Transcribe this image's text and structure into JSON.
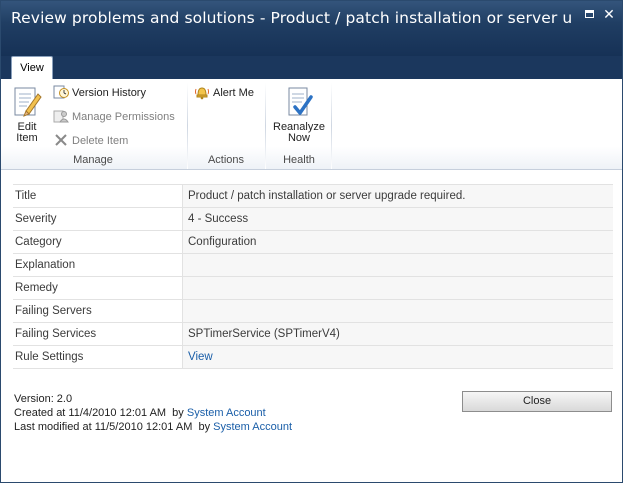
{
  "window": {
    "title": "Review problems and solutions - Product / patch installation or server upgra...",
    "maximize_icon": "maximize-icon",
    "close_label": "✕"
  },
  "ribbon": {
    "tabs": [
      {
        "label": "View",
        "selected": true
      }
    ],
    "manage": {
      "group_label": "Manage",
      "edit_item": {
        "line1": "Edit",
        "line2": "Item"
      },
      "version_history": "Version History",
      "manage_permissions": "Manage Permissions",
      "delete_item": "Delete Item"
    },
    "actions": {
      "group_label": "Actions",
      "alert_me": "Alert Me"
    },
    "health": {
      "group_label": "Health",
      "reanalyze": {
        "line1": "Reanalyze",
        "line2": "Now"
      }
    }
  },
  "properties": [
    {
      "name": "Title",
      "value": "Product / patch installation or server upgrade required."
    },
    {
      "name": "Severity",
      "value": "4 - Success"
    },
    {
      "name": "Category",
      "value": "Configuration"
    },
    {
      "name": "Explanation",
      "value": ""
    },
    {
      "name": "Remedy",
      "value": ""
    },
    {
      "name": "Failing Servers",
      "value": ""
    },
    {
      "name": "Failing Services",
      "value": "SPTimerService (SPTimerV4)"
    },
    {
      "name": "Rule Settings",
      "value": "View",
      "is_link": true
    }
  ],
  "footer": {
    "version": "Version: 2.0",
    "created_prefix": "Created at 11/4/2010 12:01 AM  by ",
    "created_by": "System Account",
    "modified_prefix": "Last modified at 11/5/2010 12:01 AM  by ",
    "modified_by": "System Account",
    "close_label": "Close"
  },
  "colors": {
    "title_bar": "#1f3c61",
    "link": "#1a5ea8"
  }
}
